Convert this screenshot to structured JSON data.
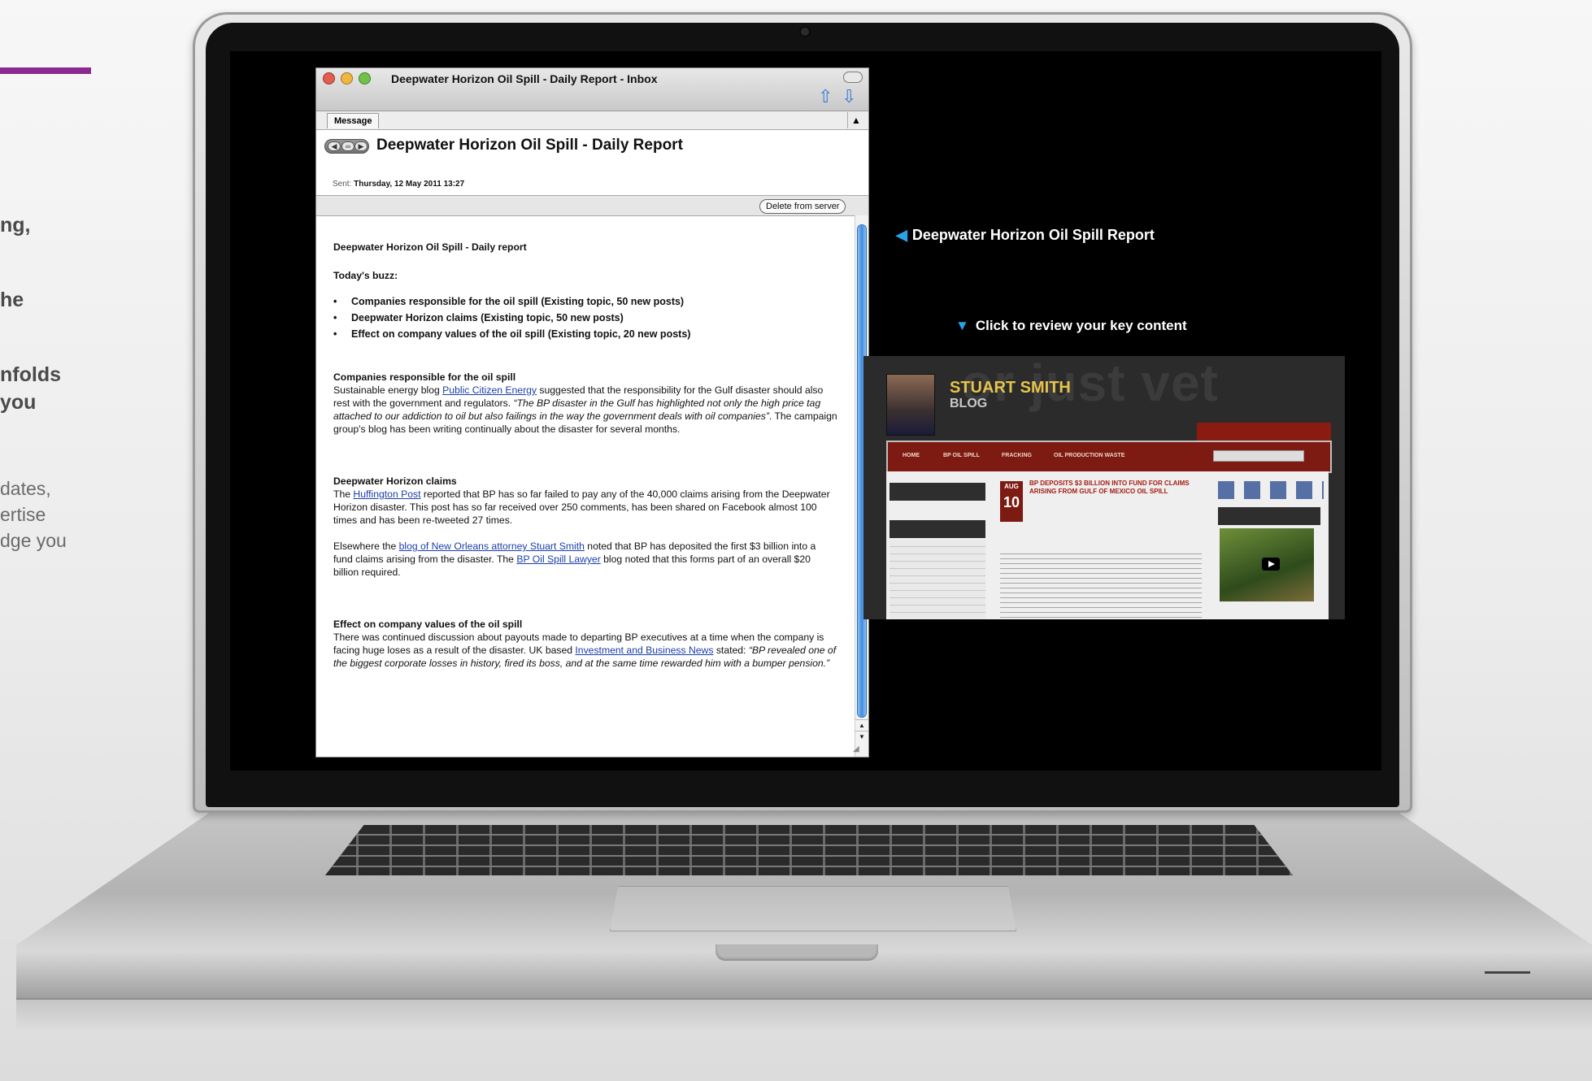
{
  "promo": {
    "lines": [
      "ng,",
      "he",
      "nfolds",
      "you",
      "dates,",
      "ertise",
      "dge you"
    ]
  },
  "window": {
    "title": "Deepwater Horizon Oil Spill - Daily Report - Inbox",
    "tab_label": "Message",
    "subject": "Deepwater Horizon Oil Spill - Daily Report",
    "sent_label": "Sent:",
    "sent_value": "Thursday, 12 May 2011 13:27",
    "delete_button": "Delete from server"
  },
  "email": {
    "heading": "Deepwater Horizon Oil Spill - Daily report",
    "buzz_label": "Today's buzz:",
    "buzz_items": [
      "Companies responsible for the oil spill (Existing topic, 50 new posts)",
      "Deepwater Horizon claims (Existing topic, 50 new posts)",
      "Effect on company values of the oil spill (Existing topic, 20 new posts)"
    ],
    "s1": {
      "title": "Companies responsible for the oil spill",
      "t1": "Sustainable energy blog ",
      "link1": "Public Citizen Energy",
      "t2": " suggested that the responsibility for the Gulf disaster should also rest with the government and regulators. ",
      "quote": "“The BP disaster in the Gulf has highlighted not only the high price tag attached to our addiction to oil but also failings in the way the government deals with oil companies”",
      "t3": ". The campaign group's blog has been writing continually about the disaster for several months."
    },
    "s2": {
      "title": "Deepwater Horizon claims",
      "t1": "The ",
      "link1": "Huffington Post",
      "t2": " reported that BP has so far failed to pay any of the 40,000 claims arising from the Deepwater Horizon disaster. This post has so far received over 250 comments, has been shared on Facebook almost 100 times and has been re-tweeted 27 times.",
      "t3": "Elsewhere the ",
      "link2": "blog of New Orleans attorney Stuart Smith",
      "t4": " noted that BP has deposited the first $3 billion into a fund claims arising from the disaster. The ",
      "link3": "BP Oil Spill Lawyer",
      "t5": " blog noted that this forms part of an overall $20 billion required."
    },
    "s3": {
      "title": "Effect on company values of the oil spill",
      "t1": "There was continued discussion about payouts made to departing BP executives at a time when the company is facing huge loses as a result of the disaster. UK based ",
      "link1": "Investment and Business News",
      "t2": " stated: ",
      "quote": "“BP revealed one of the biggest corporate losses in history, fired its boss, and at the same time rewarded him with a bumper pension.”"
    }
  },
  "annotations": {
    "report": "Deepwater Horizon Oil Spill Report",
    "review": "Click to review your key content"
  },
  "blog": {
    "bg_text": "or just vet",
    "name_top": "STUART SMITH",
    "name_bottom": "BLOG",
    "nav": [
      "HOME",
      "BP OIL SPILL",
      "FRACKING",
      "OIL PRODUCTION WASTE"
    ],
    "date_month": "AUG",
    "date_day": "10",
    "headline": "BP DEPOSITS $3 BILLION INTO FUND FOR CLAIMS ARISING FROM GULF OF MEXICO OIL SPILL"
  },
  "colors": {
    "accent_purple": "#8a2a8e",
    "link_blue": "#1a3fa8",
    "annotation_blue": "#27a3ea"
  }
}
